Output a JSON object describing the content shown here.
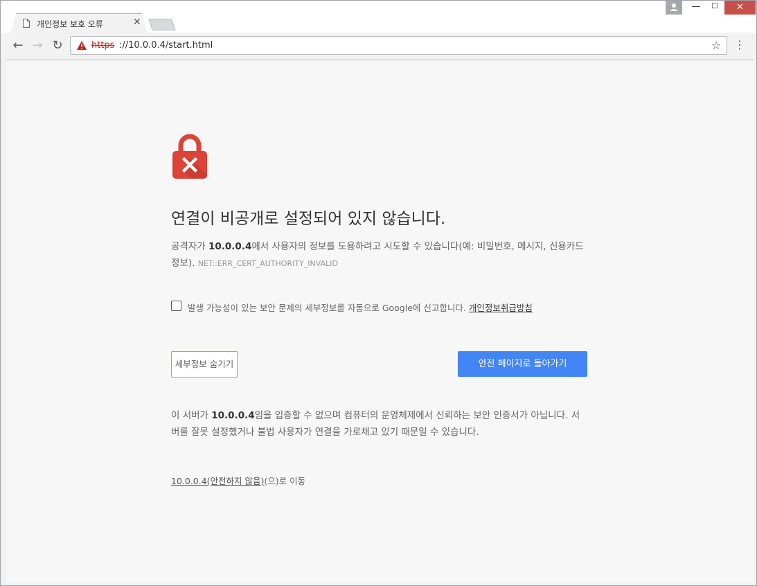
{
  "tab": {
    "title": "개인정보 보호 오류",
    "close_glyph": "✕"
  },
  "window": {
    "minimize_glyph": "—",
    "maximize_glyph": "☐",
    "close_glyph": "✕"
  },
  "toolbar": {
    "back_glyph": "←",
    "forward_glyph": "→",
    "reload_glyph": "↻",
    "url_scheme": "https",
    "url_rest": "://10.0.0.4/start.html",
    "star_glyph": "☆",
    "menu_glyph": "⋮"
  },
  "page": {
    "heading": "연결이 비공개로 설정되어 있지 않습니다.",
    "desc_pre": "공격자가 ",
    "desc_host": "10.0.0.4",
    "desc_post": "에서 사용자의 정보를 도용하려고 시도할 수 있습니다(예: 비밀번호, 메시지, 신용카드 정보). ",
    "error_code": "NET::ERR_CERT_AUTHORITY_INVALID",
    "report_text": "발생 가능성이 있는 보안 문제의 세부정보를 자동으로 Google에 신고합니다. ",
    "report_link": "개인정보취급방침",
    "details_button": "세부정보 숨기기",
    "back_button": "안전 페이지로 돌아가기",
    "details_pre": "이 서버가 ",
    "details_host": "10.0.0.4",
    "details_post": "임을 입증할 수 없으며 컴퓨터의 운영체제에서 신뢰하는 보안 인증서가 아닙니다. 서버를 잘못 설정했거나 불법 사용자가 연결을 가로채고 있기 때문일 수 있습니다.",
    "proceed_link": "10.0.0.4(안전하지 않음)",
    "proceed_suffix": "(으)로 이동"
  },
  "colors": {
    "lock_red": "#db4437",
    "primary_button": "#4285f4",
    "url_scheme_red": "#c5221f",
    "window_close": "#c7504a"
  },
  "icons": {
    "tab_icon": "document-icon",
    "lock_icon": "broken-lock-icon",
    "warning_icon": "warning-triangle-icon"
  }
}
